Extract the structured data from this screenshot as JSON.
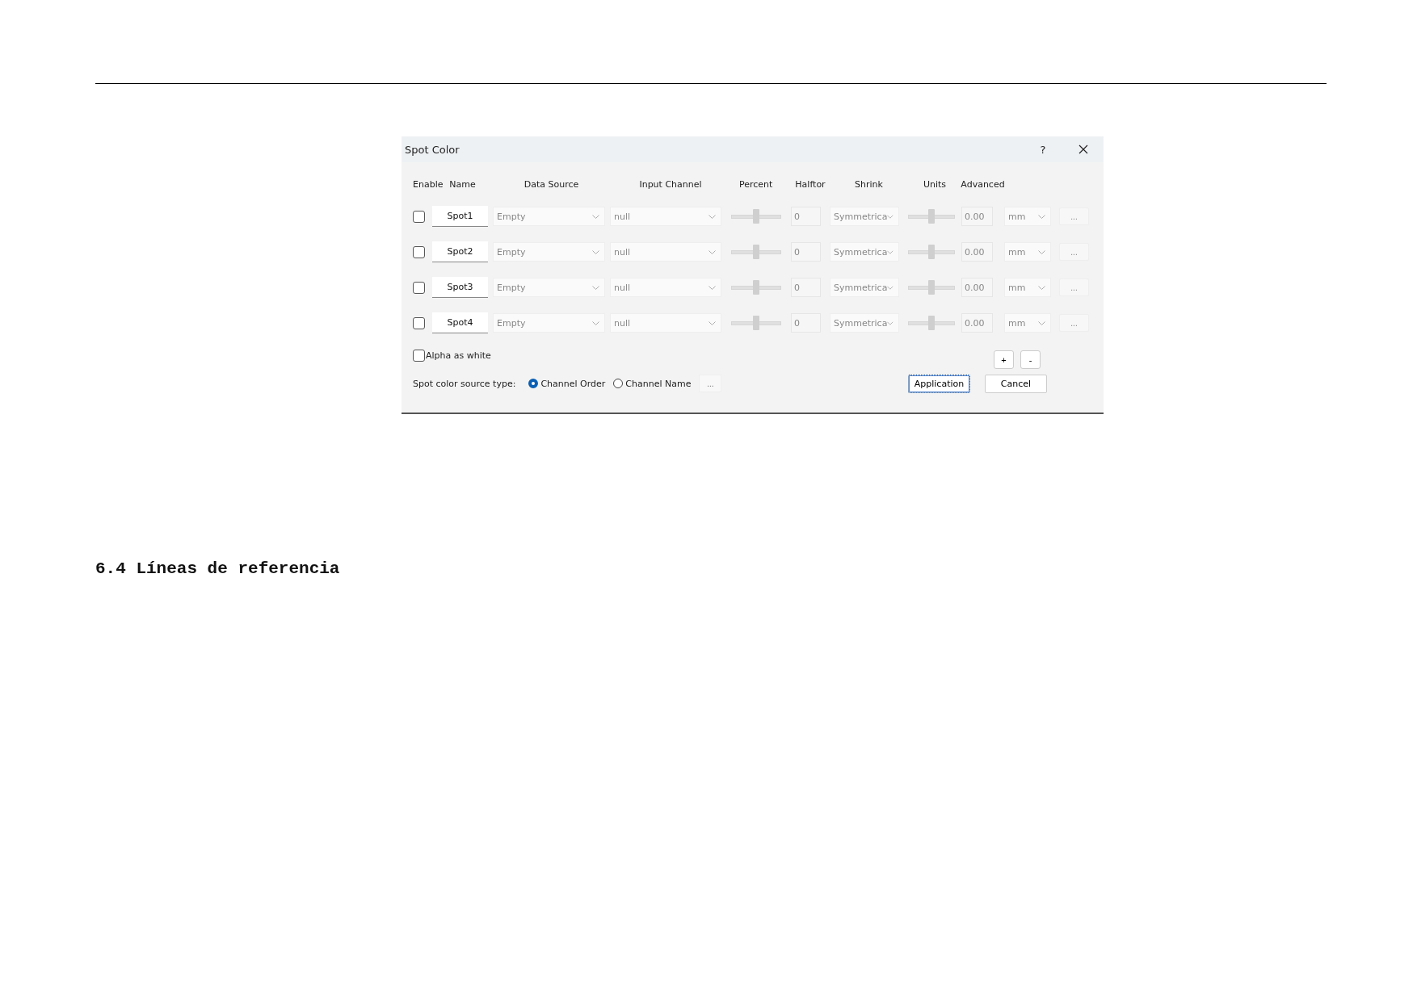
{
  "heading": "6.4 Líneas de referencia",
  "dialog": {
    "title": "Spot Color",
    "help": "?",
    "columns": [
      "Enable",
      "Name",
      "Data Source",
      "Input Channel",
      "Percent",
      "Halftor",
      "Shrink",
      "Units",
      "Advanced"
    ],
    "rows": [
      {
        "enabled": false,
        "name": "Spot1",
        "data_source": "Empty",
        "input_channel": "null",
        "percent": {
          "level": 0.5,
          "value": "0"
        },
        "halftone": "Symmetrica",
        "shrink": {
          "level": 0.5,
          "value": "0.00"
        },
        "units": "mm",
        "advanced": "...",
        "disabled": true
      },
      {
        "enabled": false,
        "name": "Spot2",
        "data_source": "Empty",
        "input_channel": "null",
        "percent": {
          "level": 0.5,
          "value": "0"
        },
        "halftone": "Symmetrica",
        "shrink": {
          "level": 0.5,
          "value": "0.00"
        },
        "units": "mm",
        "advanced": "...",
        "disabled": true
      },
      {
        "enabled": false,
        "name": "Spot3",
        "data_source": "Empty",
        "input_channel": "null",
        "percent": {
          "level": 0.5,
          "value": "0"
        },
        "halftone": "Symmetrica",
        "shrink": {
          "level": 0.5,
          "value": "0.00"
        },
        "units": "mm",
        "advanced": "...",
        "disabled": true
      },
      {
        "enabled": false,
        "name": "Spot4",
        "data_source": "Empty",
        "input_channel": "null",
        "percent": {
          "level": 0.5,
          "value": "0"
        },
        "halftone": "Symmetrica",
        "shrink": {
          "level": 0.5,
          "value": "0.00"
        },
        "units": "mm",
        "advanced": "...",
        "disabled": true
      }
    ],
    "add": "+",
    "remove": "-",
    "alpha_as_white": {
      "label": "Alpha as white",
      "checked": false
    },
    "source_type": {
      "label": "Spot color source type:",
      "options": [
        {
          "label": "Channel Order",
          "selected": true
        },
        {
          "label": "Channel Name",
          "selected": false
        }
      ],
      "more": "..."
    },
    "buttons": [
      {
        "label": "Application",
        "focused": true
      },
      {
        "label": "Cancel",
        "focused": false
      }
    ]
  }
}
